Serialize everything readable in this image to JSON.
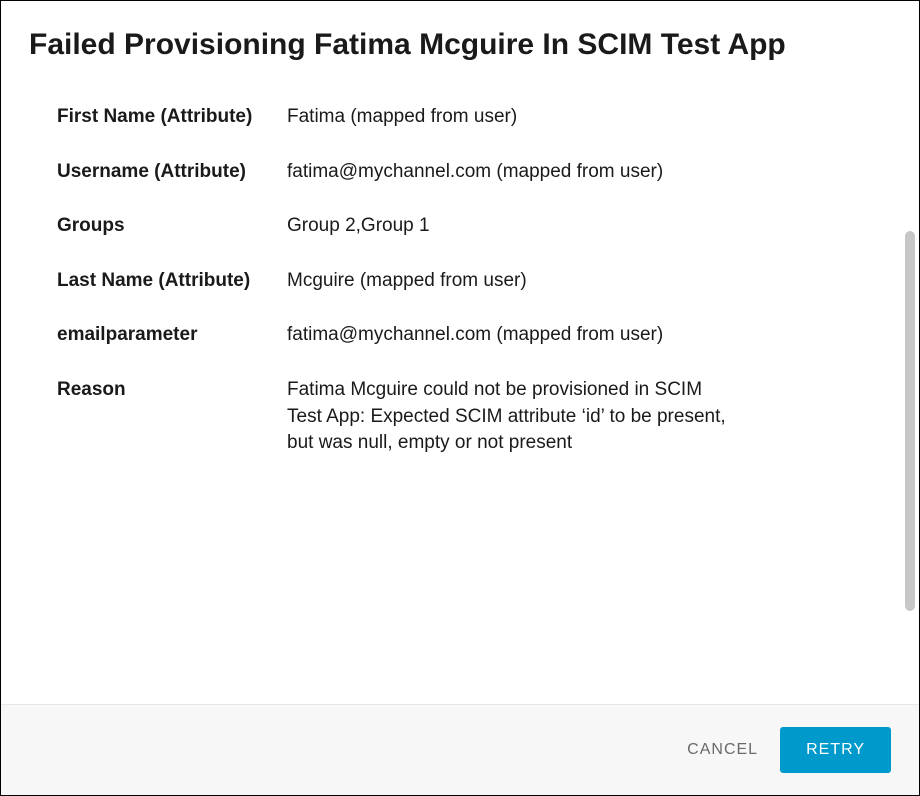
{
  "dialog": {
    "title": "Failed Provisioning Fatima Mcguire In SCIM Test App",
    "fields": [
      {
        "label": "First Name (Attribute)",
        "value": "Fatima (mapped from user)"
      },
      {
        "label": "Username (Attribute)",
        "value": "fatima@mychannel.com (mapped from user)"
      },
      {
        "label": "Groups",
        "value": "Group 2,Group 1"
      },
      {
        "label": "Last Name (Attribute)",
        "value": "Mcguire (mapped from user)"
      },
      {
        "label": "emailparameter",
        "value": "fatima@mychannel.com (mapped from user)"
      },
      {
        "label": "Reason",
        "value": "Fatima Mcguire could not be provisioned in SCIM Test App: Expected SCIM attribute ‘id’ to be present, but was null, empty or not present"
      }
    ],
    "cancel_label": "CANCEL",
    "retry_label": "RETRY"
  }
}
